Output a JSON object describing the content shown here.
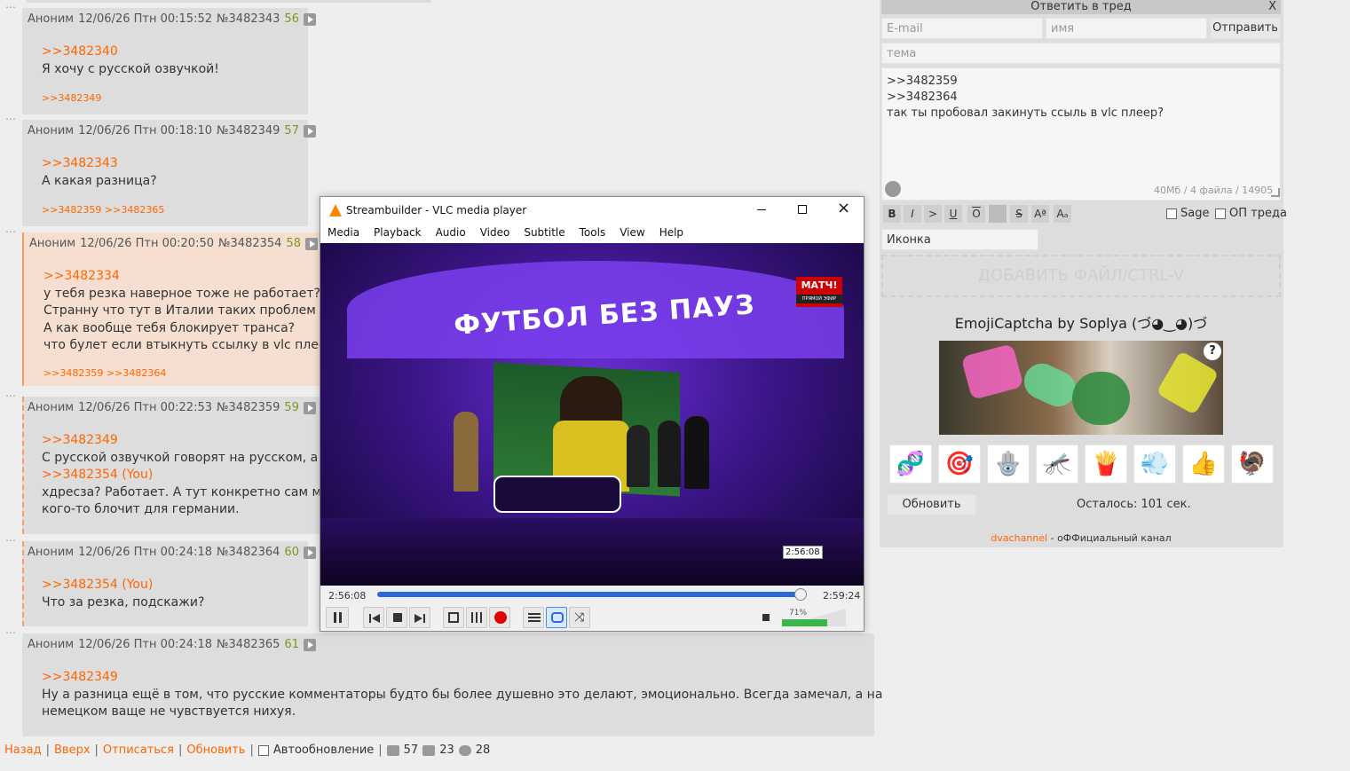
{
  "posts": [
    {
      "author": "Аноним",
      "date": "12/06/26 Птн 00:15:52",
      "id": "№3482343",
      "num": "56",
      "lines": [
        ">>3482340",
        "Я хочу с русской озвучкой!"
      ],
      "replies": ">>3482349"
    },
    {
      "author": "Аноним",
      "date": "12/06/26 Птн 00:18:10",
      "id": "№3482349",
      "num": "57",
      "lines": [
        ">>3482343",
        "А какая разница?"
      ],
      "replies": ">>3482359 >>3482365"
    },
    {
      "author": "Аноним",
      "date": "12/06/26 Птн 00:20:50",
      "id": "№3482354",
      "num": "58",
      "lines": [
        ">>3482334",
        "у тебя резка наверное тоже не работает?",
        "Странну что тут в Италии таких проблем нет,",
        "А как вообще тебя блокирует транса?",
        "что булет если втыкнуть ссылку в vlc плеер?"
      ],
      "replies": ">>3482359 >>3482364"
    },
    {
      "author": "Аноним",
      "date": "12/06/26 Птн 00:22:53",
      "id": "№3482359",
      "num": "59",
      "lines": [
        ">>3482349",
        "С русской озвучкой говорят на русском, а с н",
        ">>3482354 (You)",
        "хдресза? Работает. А тут конкретно сам матч",
        "кого-то блочит для германии."
      ],
      "replies": ""
    },
    {
      "author": "Аноним",
      "date": "12/06/26 Птн 00:24:18",
      "id": "№3482364",
      "num": "60",
      "lines": [
        ">>3482354 (You)",
        "Что за резка, подскажи?"
      ],
      "replies": ""
    },
    {
      "author": "Аноним",
      "date": "12/06/26 Птн 00:24:18",
      "id": "№3482365",
      "num": "61",
      "lines": [
        ">>3482349",
        "Ну а разница ещё в том, что русские комментаторы будто бы более душевно это делают, эмоционально. Всегда замечал, а на",
        "немецком ваще не чувствуется нихуя."
      ],
      "replies": ""
    }
  ],
  "bottom_nav": {
    "back": "Назад",
    "up": "Вверх",
    "unsubscribe": "Отписаться",
    "refresh": "Обновить",
    "autorefresh": "Автообновление",
    "posts_count": "57",
    "images_count": "23",
    "users_count": "28"
  },
  "form": {
    "title": "Ответить в тред",
    "close": "X",
    "email_placeholder": "E-mail",
    "name_placeholder": "имя",
    "submit": "Отправить",
    "subject_placeholder": "тема",
    "message_lines": [
      ">>3482359",
      ">>3482364",
      "так ты пробовал закинуть ссыль в vlc плеер?"
    ],
    "limits": "40Мб / 4 файла / 14905",
    "toolbar": [
      "B",
      "I",
      ">",
      "U",
      "O",
      "",
      "S",
      "Aª",
      "Aₐ"
    ],
    "sage_label": "Sage",
    "op_label": "ОП треда",
    "icon_select": "Иконка",
    "add_file": "ДОБАВИТЬ ФАЙЛ/CTRL-V",
    "captcha_title": "EmojiCaptcha by Soplya (づ◕‿◕)づ",
    "captcha_help": "?",
    "captcha_options": [
      "🧬",
      "🎯",
      "🪬",
      "🦟",
      "🍟",
      "💨",
      "👍",
      "🦃"
    ],
    "refresh_captcha": "Обновить",
    "time_left": "Осталось: 101 сек.",
    "footer_link": "dvachannel",
    "footer_text": " - оФФициальный канал"
  },
  "vlc": {
    "title": "Streambuilder - VLC media player",
    "menu": [
      "Media",
      "Playback",
      "Audio",
      "Video",
      "Subtitle",
      "Tools",
      "View",
      "Help"
    ],
    "overlay_banner": "ФУТБОЛ БЕЗ ПАУЗ",
    "channel_logo": "МАТЧ!",
    "channel_sub": "ПРЯМОЙ ЭФИР",
    "tooltip_time": "2:56:08",
    "time_elapsed": "2:56:08",
    "time_total": "2:59:24",
    "progress": 0.985,
    "volume_label": "71%",
    "volume": 0.71,
    "accent": "#ff8800"
  }
}
